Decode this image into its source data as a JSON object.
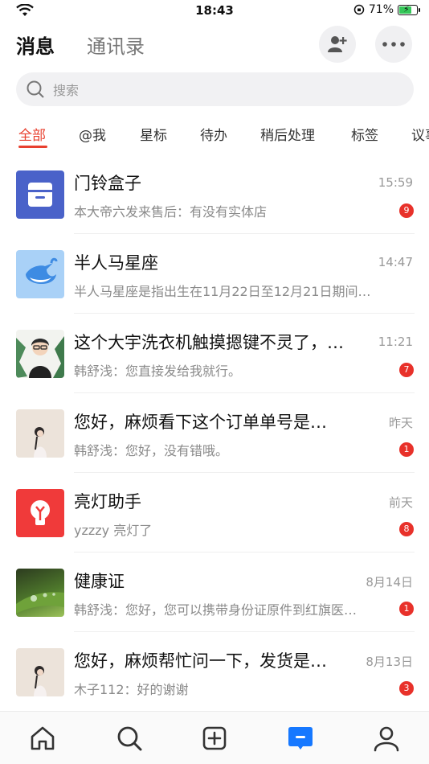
{
  "status_bar": {
    "time": "18:43",
    "battery_percent": "71%",
    "battery_level": 0.71
  },
  "header": {
    "tab_messages": "消息",
    "tab_contacts": "通讯录"
  },
  "search": {
    "placeholder": "搜索"
  },
  "filters": [
    {
      "label": "全部",
      "active": true
    },
    {
      "label": "@我"
    },
    {
      "label": "星标"
    },
    {
      "label": "待办"
    },
    {
      "label": "稍后处理"
    },
    {
      "label": "标签"
    },
    {
      "label": "议事"
    }
  ],
  "conversations": [
    {
      "title": "门铃盒子",
      "time": "15:59",
      "preview": "本大帝六发来售后：有没有实体店",
      "badge": "9",
      "avatar": "box-icon"
    },
    {
      "title": "半人马星座",
      "time": "14:47",
      "preview": "半人马星座是指出生在11月22日至12月21日期间…",
      "badge": "",
      "avatar": "whale-icon"
    },
    {
      "title": "这个大宇洗衣机触摸摁键不灵了，…",
      "time": "11:21",
      "preview": "韩舒浅：您直接发给我就行。",
      "badge": "7",
      "avatar": "person-avatar"
    },
    {
      "title": "您好，麻烦看下这个订单单号是…",
      "time": "昨天",
      "preview": "韩舒浅：您好，没有错哦。",
      "badge": "1",
      "avatar": "girl-avatar"
    },
    {
      "title": "亮灯助手",
      "time": "前天",
      "preview": "yzzzy 亮灯了",
      "badge": "8",
      "avatar": "lightbulb-icon"
    },
    {
      "title": "健康证",
      "time": "8月14日",
      "preview": "韩舒浅：您好，您可以携带身份证原件到红旗医…",
      "badge": "1",
      "avatar": "leaf-photo"
    },
    {
      "title": "您好，麻烦帮忙问一下，发货是…",
      "time": "8月13日",
      "preview": "木子112：好的谢谢",
      "badge": "3",
      "avatar": "girl-avatar"
    }
  ],
  "colors": {
    "accent": "#e8402f",
    "badge": "#e8312a",
    "tab_active": "#1678ff"
  },
  "tabbar": [
    "home-icon",
    "search-icon",
    "add-icon",
    "messages-icon",
    "profile-icon"
  ]
}
